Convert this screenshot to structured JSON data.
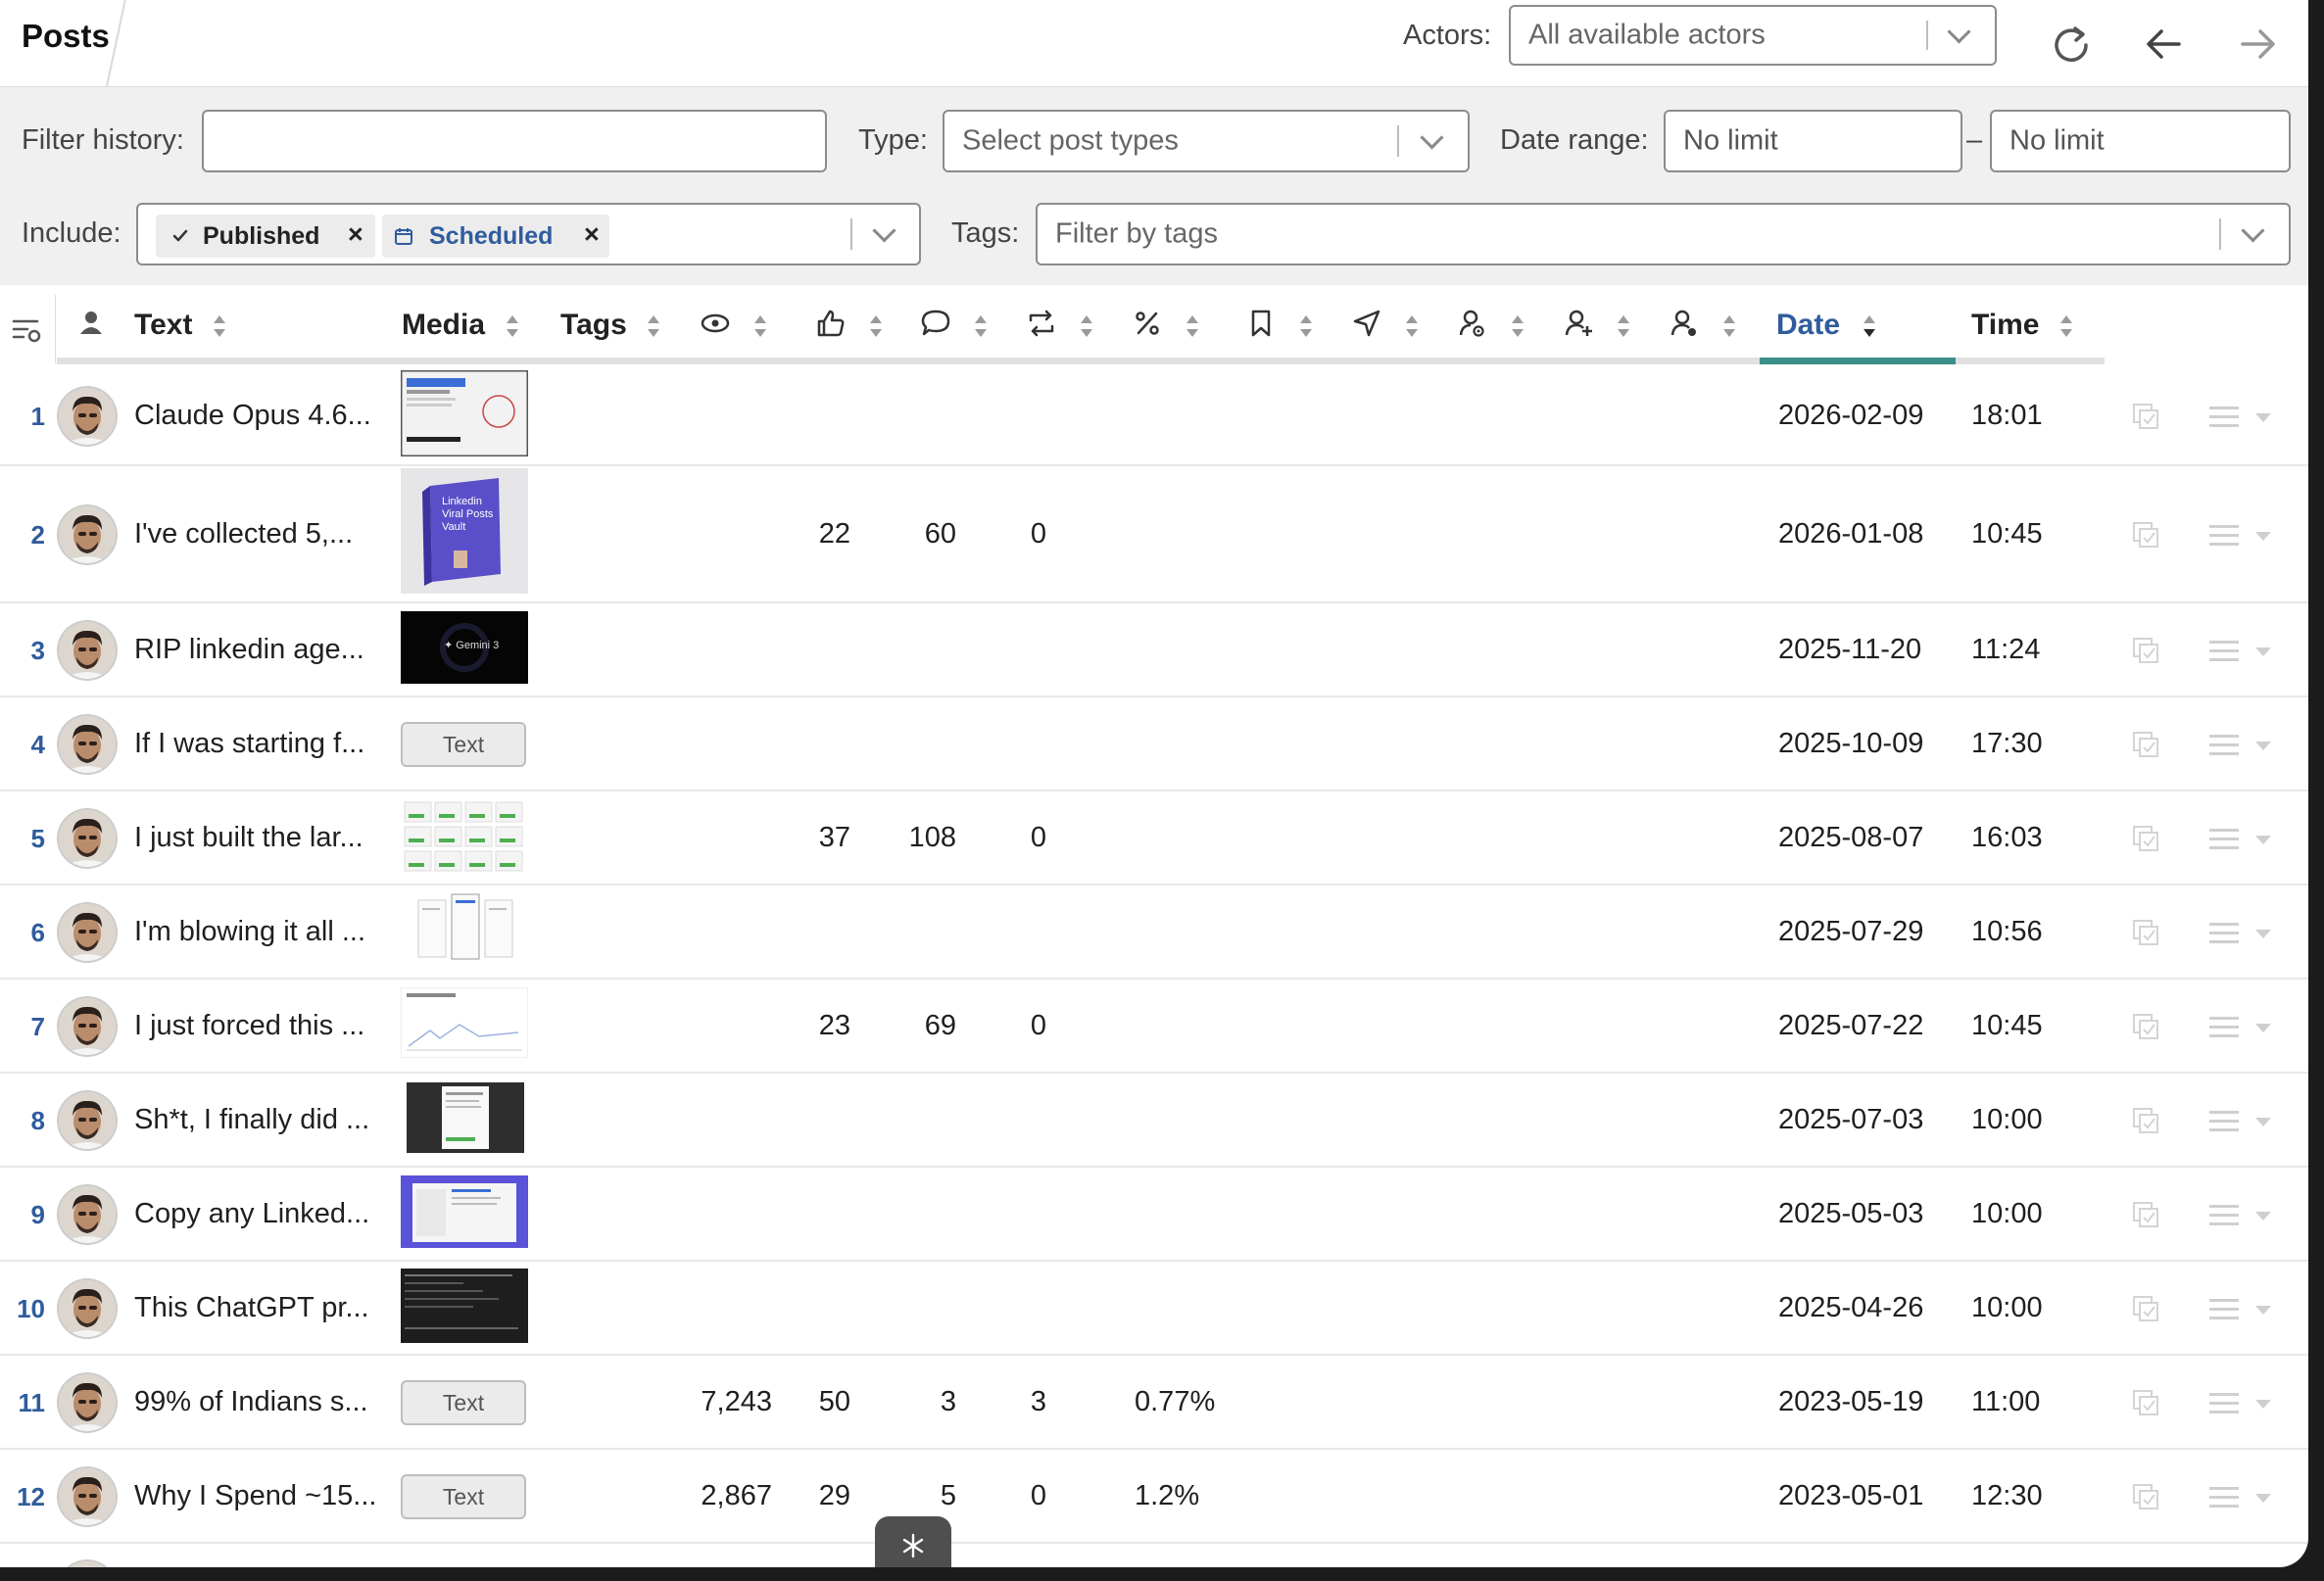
{
  "topbar": {
    "tab_title": "Posts",
    "actors_label": "Actors:",
    "actors_value": "All available actors",
    "icons": [
      "refresh-icon",
      "arrow-left-icon",
      "arrow-right-icon"
    ]
  },
  "filters": {
    "history_label": "Filter history:",
    "history_value": "",
    "type_label": "Type:",
    "type_placeholder": "Select post types",
    "date_range_label": "Date range:",
    "date_from": "No limit",
    "date_dash": "–",
    "date_to": "No limit",
    "include_label": "Include:",
    "include_chips": [
      {
        "label": "Published",
        "icon": "check-icon",
        "color": "#222222"
      },
      {
        "label": "Scheduled",
        "icon": "calendar-icon",
        "color": "#2f5c9d"
      }
    ],
    "chip_remove": "×",
    "tags_label": "Tags:",
    "tags_placeholder": "Filter by tags"
  },
  "table": {
    "columns": {
      "text": "Text",
      "media": "Media",
      "tags": "Tags",
      "date": "Date",
      "time": "Time"
    },
    "icon_columns": [
      "author-icon",
      "views-icon",
      "likes-icon",
      "comments-icon",
      "reposts-icon",
      "engagement-rate-icon",
      "saves-icon",
      "sends-icon",
      "profile-views-icon",
      "followers-gained-icon",
      "members-reached-icon"
    ],
    "sorted_column": "Date",
    "sort_direction": "descending",
    "accent_color": "#3a8f88",
    "rows": [
      {
        "num": "1",
        "text": "Claude Opus 4.6...",
        "media": "image-doc",
        "views": "",
        "likes": "",
        "comments": "",
        "reposts": "",
        "rate": "",
        "date": "2026-02-09",
        "time": "18:01"
      },
      {
        "num": "2",
        "text": "I've collected 5,...",
        "media": "image-vault",
        "views": "",
        "likes": "22",
        "comments": "60",
        "reposts": "0",
        "rate": "",
        "date": "2026-01-08",
        "time": "10:45"
      },
      {
        "num": "3",
        "text": "RIP linkedin age...",
        "media": "image-gemini",
        "views": "",
        "likes": "",
        "comments": "",
        "reposts": "",
        "rate": "",
        "date": "2025-11-20",
        "time": "11:24"
      },
      {
        "num": "4",
        "text": "If I was starting f...",
        "media": "text",
        "views": "",
        "likes": "",
        "comments": "",
        "reposts": "",
        "rate": "",
        "date": "2025-10-09",
        "time": "17:30"
      },
      {
        "num": "5",
        "text": "I just built the lar...",
        "media": "image-grid",
        "views": "",
        "likes": "37",
        "comments": "108",
        "reposts": "0",
        "rate": "",
        "date": "2025-08-07",
        "time": "16:03"
      },
      {
        "num": "6",
        "text": "I'm blowing it all ...",
        "media": "image-pages",
        "views": "",
        "likes": "",
        "comments": "",
        "reposts": "",
        "rate": "",
        "date": "2025-07-29",
        "time": "10:56"
      },
      {
        "num": "7",
        "text": "I just forced this ...",
        "media": "image-chart",
        "views": "",
        "likes": "23",
        "comments": "69",
        "reposts": "0",
        "rate": "",
        "date": "2025-07-22",
        "time": "10:45"
      },
      {
        "num": "8",
        "text": "Sh*t, I finally did ...",
        "media": "image-darkdoc",
        "views": "",
        "likes": "",
        "comments": "",
        "reposts": "",
        "rate": "",
        "date": "2025-07-03",
        "time": "10:00"
      },
      {
        "num": "9",
        "text": "Copy any Linked...",
        "media": "image-purple",
        "views": "",
        "likes": "",
        "comments": "",
        "reposts": "",
        "rate": "",
        "date": "2025-05-03",
        "time": "10:00"
      },
      {
        "num": "10",
        "text": "This ChatGPT pr...",
        "media": "image-dark",
        "views": "",
        "likes": "",
        "comments": "",
        "reposts": "",
        "rate": "",
        "date": "2025-04-26",
        "time": "10:00"
      },
      {
        "num": "11",
        "text": "99% of Indians s...",
        "media": "text",
        "views": "7,243",
        "likes": "50",
        "comments": "3",
        "reposts": "3",
        "rate": "0.77%",
        "date": "2023-05-19",
        "time": "11:00"
      },
      {
        "num": "12",
        "text": "Why I Spend ~15...",
        "media": "text",
        "views": "2,867",
        "likes": "29",
        "comments": "5",
        "reposts": "0",
        "rate": "1.2%",
        "date": "2023-05-01",
        "time": "12:30"
      }
    ],
    "text_media_label": "Text",
    "thumb_captions": {
      "vault": "Linkedin Viral Posts Vault",
      "gemini": "✦ Gemini 3"
    }
  }
}
